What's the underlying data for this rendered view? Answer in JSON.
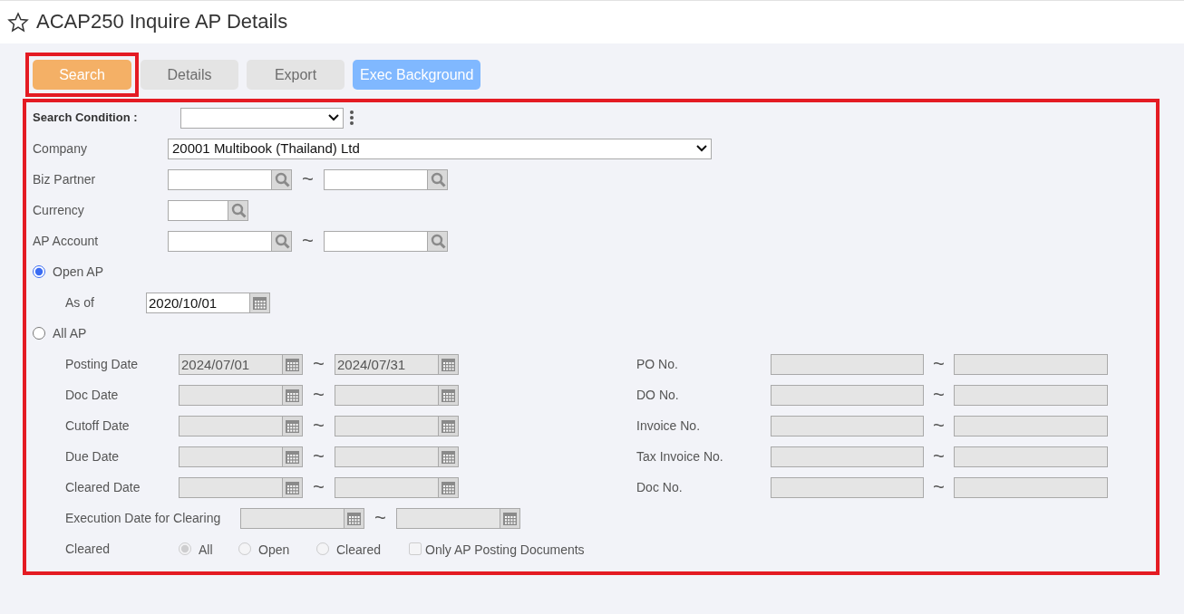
{
  "title": "ACAP250 Inquire AP Details",
  "favorite": false,
  "toolbar": [
    {
      "label": "Search",
      "kind": "primary",
      "highlighted": true
    },
    {
      "label": "Details",
      "kind": "default",
      "highlighted": false
    },
    {
      "label": "Export",
      "kind": "default",
      "highlighted": false
    },
    {
      "label": "Exec Background",
      "kind": "info",
      "highlighted": false
    }
  ],
  "form": {
    "highlighted": true,
    "search_condition": {
      "label": "Search Condition :"
    },
    "fields": [
      {
        "label": "Company",
        "kind": "select",
        "value": "20001 Multibook (Thailand) Ltd"
      },
      {
        "label": "Biz Partner",
        "kind": "lookup_range",
        "separator": "~"
      },
      {
        "label": "Currency",
        "kind": "lookup"
      },
      {
        "label": "AP Account",
        "kind": "lookup_range",
        "separator": "~"
      }
    ],
    "modes": [
      {
        "label": "Open AP",
        "selected": true,
        "disabled": false,
        "fields": [
          {
            "label": "As of",
            "value": "2020/10/01"
          }
        ]
      },
      {
        "label": "All AP",
        "selected": false,
        "disabled": true,
        "rows": [
          {
            "left": {
              "label": "Posting Date",
              "from": "2024/07/01",
              "to": "2024/07/31",
              "separator": "~"
            },
            "right": {
              "label": "PO No.",
              "separator": "~"
            }
          },
          {
            "left": {
              "label": "Doc Date",
              "separator": "~"
            },
            "right": {
              "label": "DO No.",
              "separator": "~"
            }
          },
          {
            "left": {
              "label": "Cutoff Date",
              "separator": "~"
            },
            "right": {
              "label": "Invoice No.",
              "separator": "~"
            }
          },
          {
            "left": {
              "label": "Due Date",
              "separator": "~"
            },
            "right": {
              "label": "Tax Invoice No.",
              "separator": "~"
            }
          },
          {
            "left": {
              "label": "Cleared Date",
              "separator": "~"
            },
            "right": {
              "label": "Doc No.",
              "separator": "~"
            }
          }
        ],
        "execution": {
          "label": "Execution Date for Clearing",
          "separator": "~"
        },
        "cleared": {
          "label": "Cleared",
          "options": [
            {
              "label": "All",
              "selected": true
            },
            {
              "label": "Open",
              "selected": false
            },
            {
              "label": "Cleared",
              "selected": false
            }
          ]
        },
        "only_ap": {
          "label": "Only AP Posting Documents",
          "checked": false
        }
      }
    ]
  }
}
